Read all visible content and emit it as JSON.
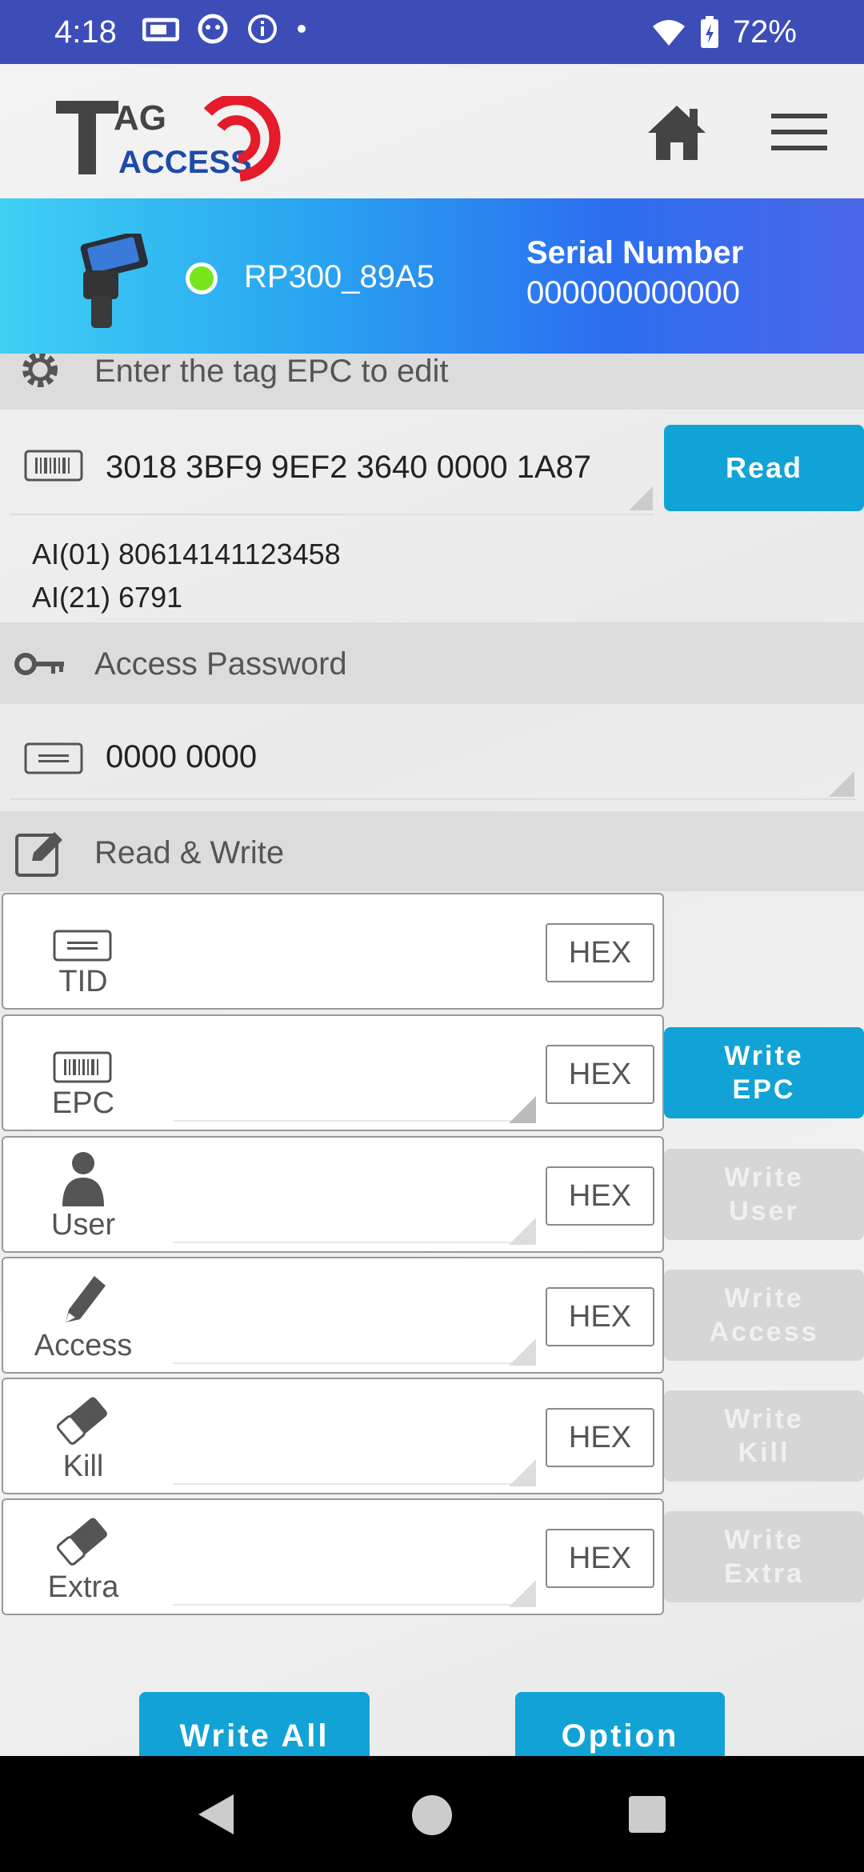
{
  "status_bar": {
    "time": "4:18",
    "battery": "72%"
  },
  "header": {
    "logo_text_top": "TAG",
    "logo_text_bottom": "ACCESS"
  },
  "device": {
    "name": "RP300_89A5",
    "serial_label": "Serial Number",
    "serial_value": "000000000000",
    "connected_color": "#77e61b"
  },
  "epc_section": {
    "title": "Enter the tag EPC to edit",
    "epc_value": "3018 3BF9 9EF2 3640 0000 1A87",
    "read_label": "Read",
    "ai_lines": [
      "AI(01) 80614141123458",
      "AI(21) 6791"
    ]
  },
  "password_section": {
    "title": "Access Password",
    "value": "0000 0000"
  },
  "rw_section": {
    "title": "Read & Write",
    "rows": [
      {
        "label": "TID",
        "hex": "HEX",
        "icon": "tid-card-icon",
        "button": ""
      },
      {
        "label": "EPC",
        "hex": "HEX",
        "icon": "barcode-icon",
        "button": "Write\nEPC",
        "active": true
      },
      {
        "label": "User",
        "hex": "HEX",
        "icon": "user-icon",
        "button": "Write\nUser",
        "active": false
      },
      {
        "label": "Access",
        "hex": "HEX",
        "icon": "pencil-icon",
        "button": "Write\nAccess",
        "active": false
      },
      {
        "label": "Kill",
        "hex": "HEX",
        "icon": "eraser-icon",
        "button": "Write\nKill",
        "active": false
      },
      {
        "label": "Extra",
        "hex": "HEX",
        "icon": "eraser-icon",
        "button": "Write\nExtra",
        "active": false
      }
    ]
  },
  "footer": {
    "write_all": "Write All",
    "option": "Option"
  },
  "colors": {
    "accent": "#11a3d6",
    "status_bar": "#3d4db8"
  }
}
